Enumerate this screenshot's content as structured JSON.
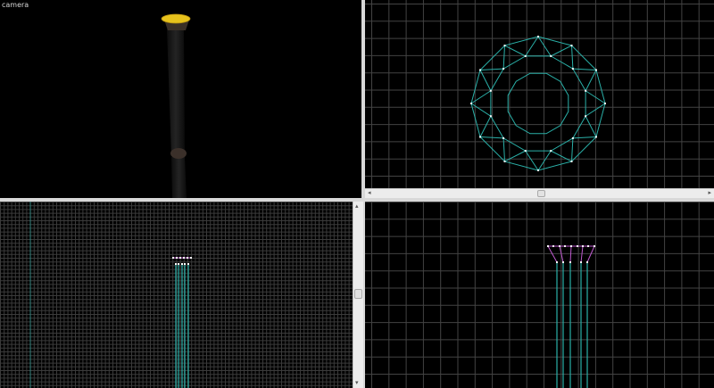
{
  "viewports": {
    "camera": {
      "label": "camera"
    }
  },
  "icons": {
    "scroll_left": "arrow-left-icon",
    "scroll_right": "arrow-right-icon",
    "scroll_up": "arrow-up-icon",
    "scroll_down": "arrow-down-icon"
  },
  "colors": {
    "viewport_bg": "#000000",
    "grid": "#5a5a5a",
    "edge": "#2ab0a8",
    "vertex": "#ffffff",
    "selected_edge": "#c05ad0",
    "selected_face": "#e7c21c"
  }
}
